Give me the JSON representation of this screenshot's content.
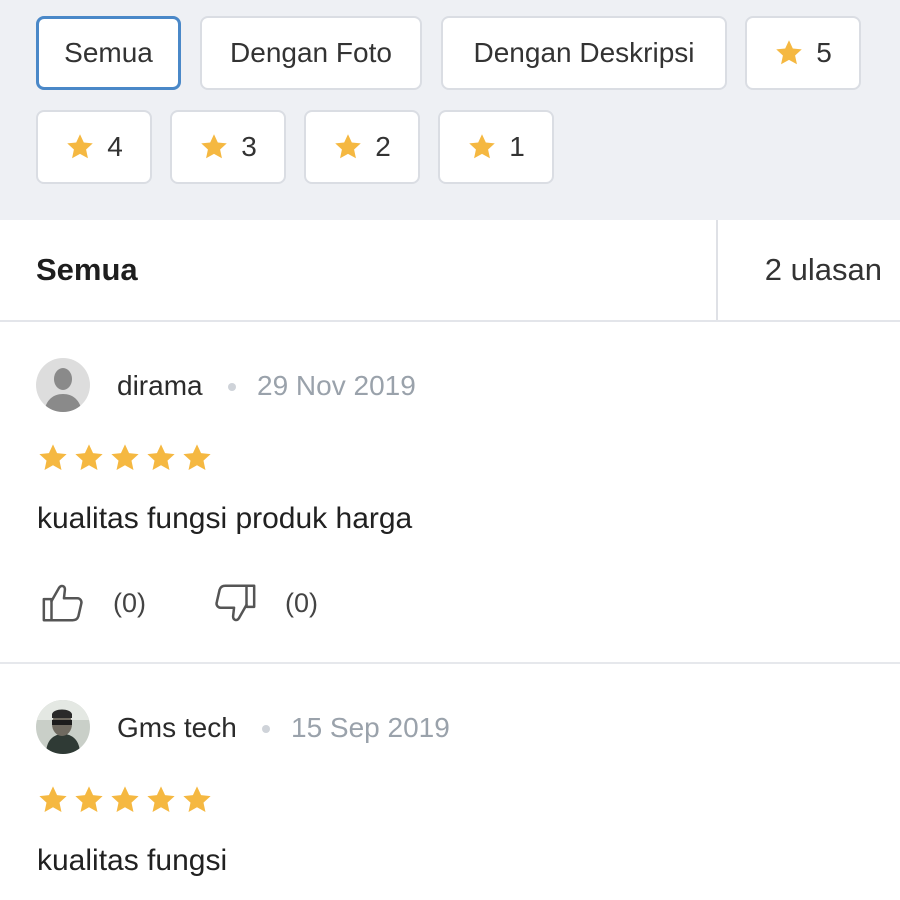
{
  "filters": {
    "all_label": "Semua",
    "photo_label": "Dengan Foto",
    "desc_label": "Dengan Deskripsi",
    "star5_label": "5",
    "star4_label": "4",
    "star3_label": "3",
    "star2_label": "2",
    "star1_label": "1"
  },
  "summary": {
    "title": "Semua",
    "count": "2 ulasan"
  },
  "reviews": [
    {
      "user": "dirama",
      "date": "29 Nov 2019",
      "rating": 5,
      "text": "kualitas fungsi produk harga",
      "likes": "(0)",
      "dislikes": "(0)"
    },
    {
      "user": "Gms tech",
      "date": "15 Sep 2019",
      "rating": 5,
      "text": "kualitas fungsi"
    }
  ],
  "icons": {
    "star": "star-icon",
    "like": "thumbs-up-icon",
    "dislike": "thumbs-down-icon",
    "avatar_default": "default-avatar-icon"
  },
  "colors": {
    "star": "#f5b841",
    "active_border": "#4a88c8",
    "filter_bg": "#eef0f4",
    "date_text": "#9aa2ab"
  }
}
